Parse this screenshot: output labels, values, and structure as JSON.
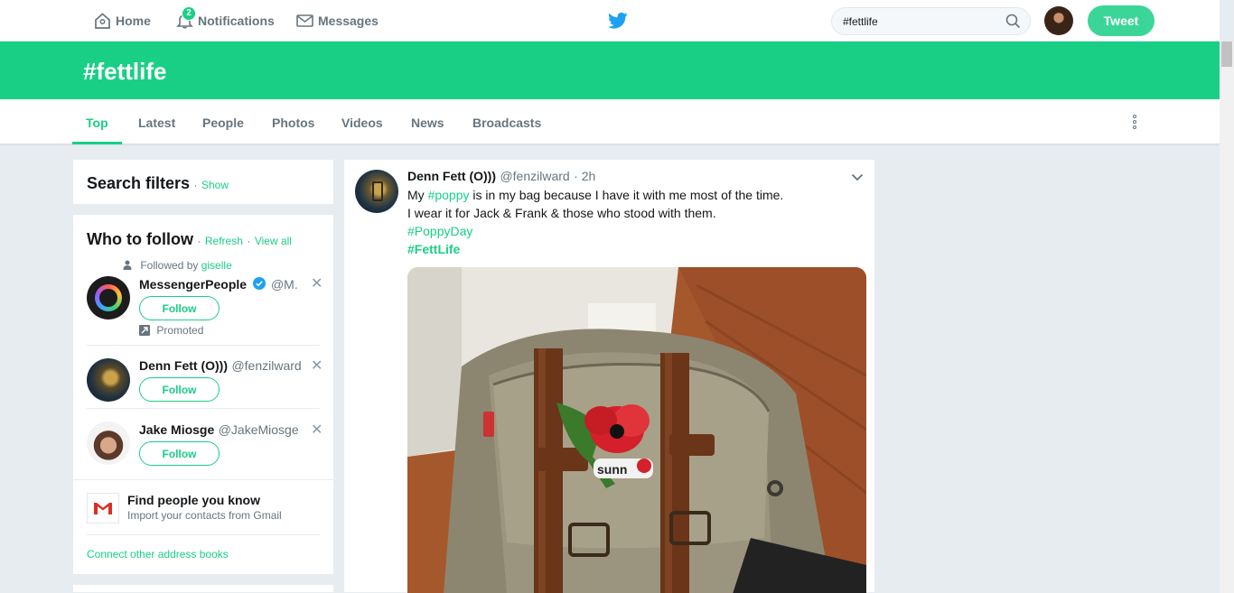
{
  "nav": {
    "home": "Home",
    "notifications": "Notifications",
    "notifications_count": "2",
    "messages": "Messages"
  },
  "search": {
    "value": "#fettlife"
  },
  "tweet_button": "Tweet",
  "header": {
    "title": "#fettlife"
  },
  "tabs": [
    "Top",
    "Latest",
    "People",
    "Photos",
    "Videos",
    "News",
    "Broadcasts"
  ],
  "search_filters": {
    "title": "Search filters",
    "show": "Show"
  },
  "who_to_follow": {
    "title": "Who to follow",
    "refresh": "Refresh",
    "view_all": "View all",
    "followed_by_prefix": "Followed by",
    "followed_by_user": "giselle",
    "follow_label": "Follow",
    "promoted": "Promoted",
    "accounts": [
      {
        "name": "MessengerPeople",
        "handle": "@M..."
      },
      {
        "name": "Denn Fett (O)))",
        "handle": "@fenzilward"
      },
      {
        "name": "Jake Miosge",
        "handle": "@JakeMiosge"
      }
    ]
  },
  "find_people": {
    "title": "Find people you know",
    "subtitle": "Import your contacts from Gmail",
    "connect": "Connect other address books"
  },
  "tweet": {
    "author": "Denn Fett (O)))",
    "handle": "@fenzilward",
    "time": "· 2h",
    "line1_pre": "My ",
    "line1_tag": "#poppy",
    "line1_post": " is in my bag because I have it with me most of the time.",
    "line2": "I wear it for Jack & Frank & those who stood with them.",
    "tag1": "#PoppyDay",
    "tag2": "#FettLife"
  },
  "colors": {
    "accent": "#19cf86",
    "text": "#14171a",
    "muted": "#66757f",
    "background": "#e6ecf0"
  }
}
